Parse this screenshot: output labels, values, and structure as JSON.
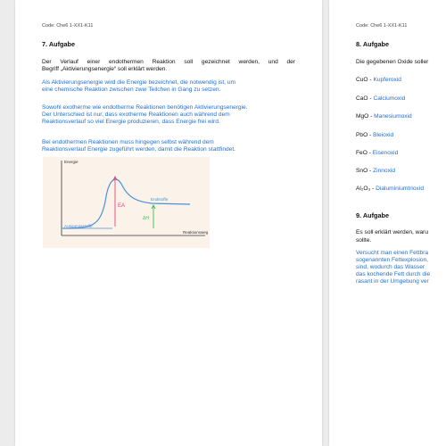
{
  "left_page": {
    "code": "Code: Che6 1-XX1-K11",
    "task_title": "7. Aufgabe",
    "question_line1": "Der Verlauf einer endothermen Reaktion soll gezeichnet werden, und der",
    "question_line2": "Begriff „Aktivierungsenergie“ soll erklärt werden.",
    "answer1_line1": "Als Aktivierungsenergie wird die Energie bezeichnet, die notwendig ist, um",
    "answer1_line2": "eine chemische Reaktion zwischen zwei Teilchen in Gang zu setzen.",
    "answer2_line1": "Sowohl exotherme wie endotherme Reaktionen benötigen Aktivierungsenergie.",
    "answer2_line2": "Der Unterschied ist nur, dass exotherme Reaktionen auch während dem",
    "answer2_line3": "Reaktionsverlauf so viel Energie produzieren, dass Energie frei wird.",
    "answer3_line1": "Bei endothermen Reaktionen muss hingegen selbst während dem",
    "answer3_line2": "Reaktionsverlauf Energie zugeführt werden, damit die Reaktion stattfindet.",
    "sketch": {
      "y_axis_label": "Energie",
      "x_axis_label": "Reaktionsweg",
      "label_reactants": "Ausgangsstoffe",
      "label_products": "Endstoffe",
      "label_activation": "EA",
      "label_delta": "ΔH",
      "colors": {
        "curve": "#4a90d9",
        "activation": "#e0457b",
        "delta": "#3fbf4f",
        "background": "#fbf3ea"
      }
    }
  },
  "right_page": {
    "code": "Code: Che6 1-XX1-K11",
    "task8_title": "8. Aufgabe",
    "task8_question": "Die gegebenen Oxide soller",
    "oxides": [
      {
        "formula": "CuO",
        "name": "Kupferoxid"
      },
      {
        "formula": "CaO",
        "name": "Calciumoxid"
      },
      {
        "formula": "MgO",
        "name": "Manesiumoxid"
      },
      {
        "formula": "PbO",
        "name": "Bleioxid"
      },
      {
        "formula": "FeO",
        "name": "Eisenoxid"
      },
      {
        "formula": "SnO",
        "name": "Zinnoxid"
      },
      {
        "formula": "Al₂O₃",
        "name": "Dialuminiumtrioxid"
      }
    ],
    "separator": " - ",
    "task9_title": "9. Aufgabe",
    "task9_q_line1": "Es soll erklärt werden, waru",
    "task9_q_line2": "sollte.",
    "task9_a_line1": "Versucht man einen Fettbra",
    "task9_a_line2": "sogenannten Fettexplosion,",
    "task9_a_line3": "sind, wodurch das Wasser",
    "task9_a_line4": "das kochende Fett durch die",
    "task9_a_line5": "rasant in der Umgebung ver"
  }
}
